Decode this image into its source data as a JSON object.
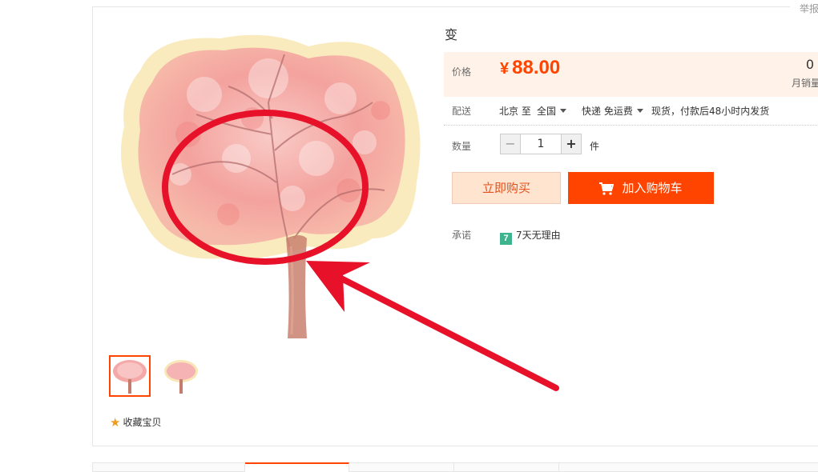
{
  "report": {
    "label": "举报"
  },
  "product": {
    "title": "变"
  },
  "price": {
    "label": "价格",
    "currency": "¥",
    "value": "88.00"
  },
  "sales": {
    "count": "0",
    "label": "月销量"
  },
  "shipping": {
    "label": "配送",
    "from": "北京 至",
    "to": "全国",
    "method": "快递 免运费",
    "note": "现货，付款后48小时内发货"
  },
  "quantity": {
    "label": "数量",
    "value": "1",
    "minus": "−",
    "plus": "+",
    "unit": "件"
  },
  "actions": {
    "buy_now": "立即购买",
    "add_to_cart": "加入购物车"
  },
  "promise": {
    "label": "承诺",
    "icon_text": "7",
    "text": "7天无理由"
  },
  "favorite": {
    "label": "收藏宝贝"
  },
  "colors": {
    "accent": "#ff4400",
    "price_bg": "#fff2e8",
    "annotation_red": "#e8112a"
  }
}
